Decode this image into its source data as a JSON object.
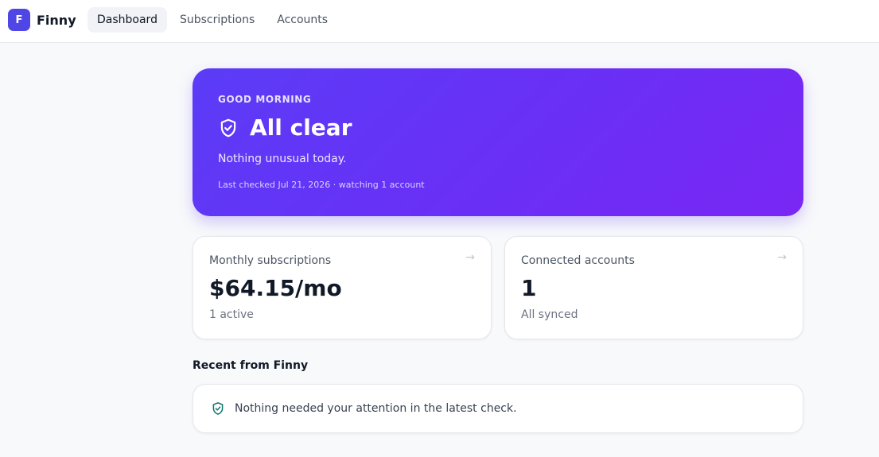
{
  "app": {
    "logo_letter": "F",
    "name": "Finny",
    "accent_color": "#4f46e5"
  },
  "nav": {
    "items": [
      {
        "label": "Dashboard",
        "active": true
      },
      {
        "label": "Subscriptions",
        "active": false
      },
      {
        "label": "Accounts",
        "active": false
      }
    ]
  },
  "hero": {
    "greeting": "GOOD MORNING",
    "icon": "shield-check-icon",
    "title": "All clear",
    "subtitle": "Nothing unusual today.",
    "meta": "Last checked Jul 21, 2026 · watching 1 account"
  },
  "cards": {
    "subscriptions": {
      "label": "Monthly subscriptions",
      "value": "$64.15/mo",
      "sub": "1 active",
      "arrow_icon": "arrow-right-icon"
    },
    "accounts": {
      "label": "Connected accounts",
      "value": "1",
      "sub": "All synced",
      "arrow_icon": "arrow-right-icon"
    }
  },
  "recent": {
    "title": "Recent from Finny",
    "items": [
      {
        "icon": "shield-check-icon",
        "text": "Nothing needed your attention in the latest check."
      }
    ]
  }
}
